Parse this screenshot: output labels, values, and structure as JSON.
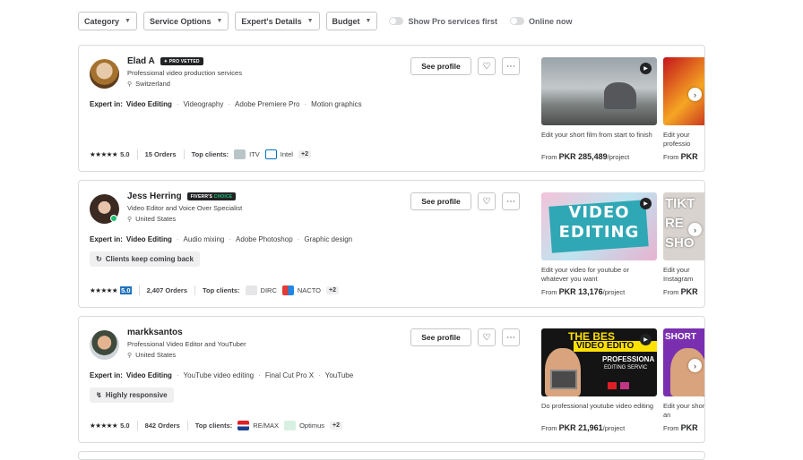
{
  "filters": {
    "category": "Category",
    "service_options": "Service Options",
    "experts_details": "Expert's Details",
    "budget": "Budget",
    "pro_toggle": "Show Pro services first",
    "online_toggle": "Online now"
  },
  "freelancers": [
    {
      "name": "Elad A",
      "badge": "PRO VETTED",
      "title": "Professional video production services",
      "country": "Switzerland",
      "expert_label": "Expert in:",
      "skills": [
        "Video Editing",
        "Videography",
        "Adobe Premiere Pro",
        "Motion graphics"
      ],
      "stars": "★★★★★",
      "rating": "5.0",
      "orders": "15 Orders",
      "top_clients_label": "Top clients:",
      "clients": [
        "ITV",
        "Intel"
      ],
      "more_clients": "+2",
      "see_profile": "See profile",
      "gig": {
        "title": "Edit your short film from start to finish",
        "price_prefix": "From",
        "price": "PKR 285,489",
        "price_suffix": "/project"
      },
      "gig2": {
        "title": "Edit your professio",
        "price_prefix": "From",
        "price": "PKR"
      }
    },
    {
      "name": "Jess Herring",
      "badge_a": "FIVERR'S",
      "badge_b": "CHOICE",
      "title": "Video Editor and Voice Over Specialist",
      "country": "United States",
      "expert_label": "Expert in:",
      "skills": [
        "Video Editing",
        "Audio mixing",
        "Adobe Photoshop",
        "Graphic design"
      ],
      "highlight": "Clients keep coming back",
      "stars": "★★★★★",
      "rating": "5.0",
      "orders": "2,407 Orders",
      "top_clients_label": "Top clients:",
      "clients": [
        "DIRC",
        "NACTO"
      ],
      "more_clients": "+2",
      "see_profile": "See profile",
      "gig": {
        "title": "Edit your video for youtube or whatever you want",
        "price_prefix": "From",
        "price": "PKR 13,176",
        "price_suffix": "/project",
        "thumb_text_1": "VIDEO",
        "thumb_text_2": "EDITING"
      },
      "gig2": {
        "title": "Edit your Instagram",
        "price_prefix": "From",
        "price": "PKR",
        "thumb_text": "TIKT RE SHO"
      }
    },
    {
      "name": "markksantos",
      "title": "Professional Video Editor and YouTuber",
      "country": "United States",
      "expert_label": "Expert in:",
      "skills": [
        "Video Editing",
        "YouTube video editing",
        "Final Cut Pro X",
        "YouTube"
      ],
      "highlight": "Highly responsive",
      "stars": "★★★★★",
      "rating": "5.0",
      "orders": "842 Orders",
      "top_clients_label": "Top clients:",
      "clients": [
        "RE/MAX",
        "Optimus"
      ],
      "more_clients": "+2",
      "see_profile": "See profile",
      "gig": {
        "title": "Do professional youtube video editing",
        "price_prefix": "From",
        "price": "PKR 21,961",
        "price_suffix": "/project",
        "thumb_text_1": "THE BES",
        "thumb_text_2": "VIDEO EDITO",
        "thumb_text_3": "PROFESSIONA",
        "thumb_text_4": "EDITING SERVIC"
      },
      "gig2": {
        "title": "Edit your shorts, an",
        "price_prefix": "From",
        "price": "PKR",
        "thumb_text": "SHORT"
      }
    }
  ],
  "colors": {
    "online": "#1dbf73",
    "rating_highlight": "#1e72bd",
    "dark": "#222325"
  }
}
